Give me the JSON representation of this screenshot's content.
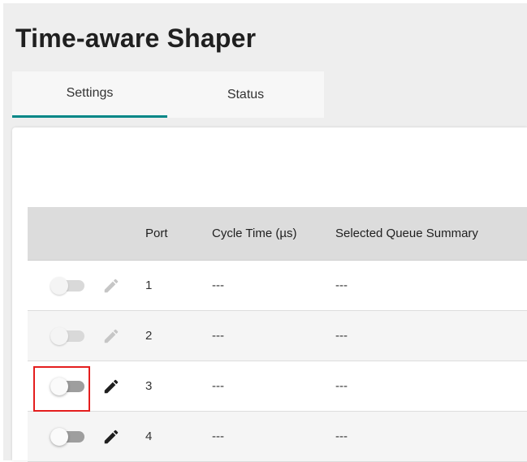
{
  "page": {
    "title": "Time-aware Shaper"
  },
  "tabs": [
    {
      "label": "Settings",
      "active": true
    },
    {
      "label": "Status",
      "active": false
    }
  ],
  "table": {
    "columns": [
      "",
      "Port",
      "Cycle Time (µs)",
      "Selected Queue Summary"
    ],
    "rows": [
      {
        "enabled": false,
        "editable": false,
        "port": "1",
        "cycle_time": "---",
        "queue_summary": "---"
      },
      {
        "enabled": false,
        "editable": false,
        "port": "2",
        "cycle_time": "---",
        "queue_summary": "---"
      },
      {
        "enabled": false,
        "editable": true,
        "port": "3",
        "cycle_time": "---",
        "queue_summary": "---"
      },
      {
        "enabled": false,
        "editable": true,
        "port": "4",
        "cycle_time": "---",
        "queue_summary": "---"
      }
    ]
  },
  "icons": {
    "toggle": "toggle-switch-icon",
    "edit": "pencil-icon"
  },
  "colors": {
    "accent": "#008787",
    "highlight": "#e41e1e",
    "icon_active": "#1f1f1f",
    "icon_disabled": "#c6c6c6"
  }
}
